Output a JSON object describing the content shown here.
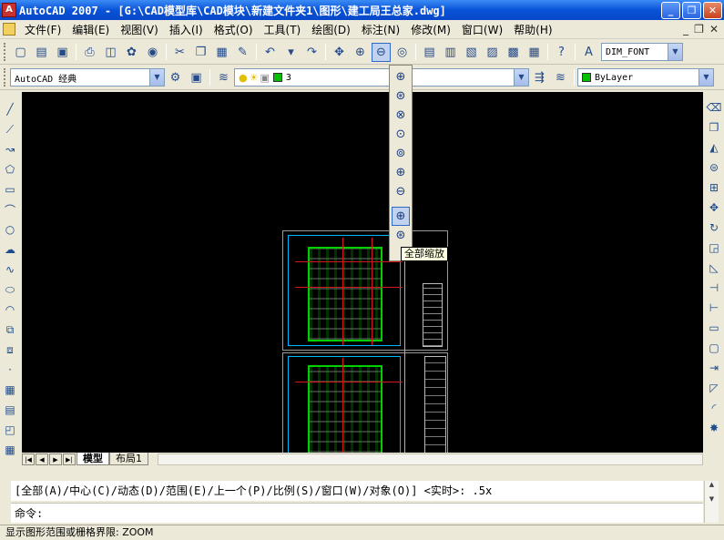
{
  "window": {
    "title": "AutoCAD 2007 - [G:\\CAD模型库\\CAD模块\\新建文件夹1\\图形\\建工局王总家.dwg]",
    "app_icon": "autocad-icon",
    "controls": [
      "_",
      "❐",
      "✕"
    ]
  },
  "menu": {
    "items": [
      "文件(F)",
      "编辑(E)",
      "视图(V)",
      "插入(I)",
      "格式(O)",
      "工具(T)",
      "绘图(D)",
      "标注(N)",
      "修改(M)",
      "窗口(W)",
      "帮助(H)"
    ],
    "doc_controls": [
      "_",
      "❐",
      "✕"
    ]
  },
  "toolbar1": {
    "dim_style": "DIM_FONT"
  },
  "toolbar2": {
    "workspace": "AutoCAD 经典",
    "layer": "3",
    "color": "ByLayer",
    "layer_color": "#00c000",
    "bylayer_color": "#00c000"
  },
  "zoom_flyout": {
    "tooltip": "全部缩放"
  },
  "tabs": {
    "items": [
      "模型",
      "布局1"
    ],
    "active": "模型"
  },
  "command": {
    "prompt_line": "[全部(A)/中心(C)/动态(D)/范围(E)/上一个(P)/比例(S)/窗口(W)/对象(O)] <实时>: .5x",
    "input_label": "命令:"
  },
  "status": {
    "text": "显示图形范围或栅格界限:  ZOOM"
  }
}
